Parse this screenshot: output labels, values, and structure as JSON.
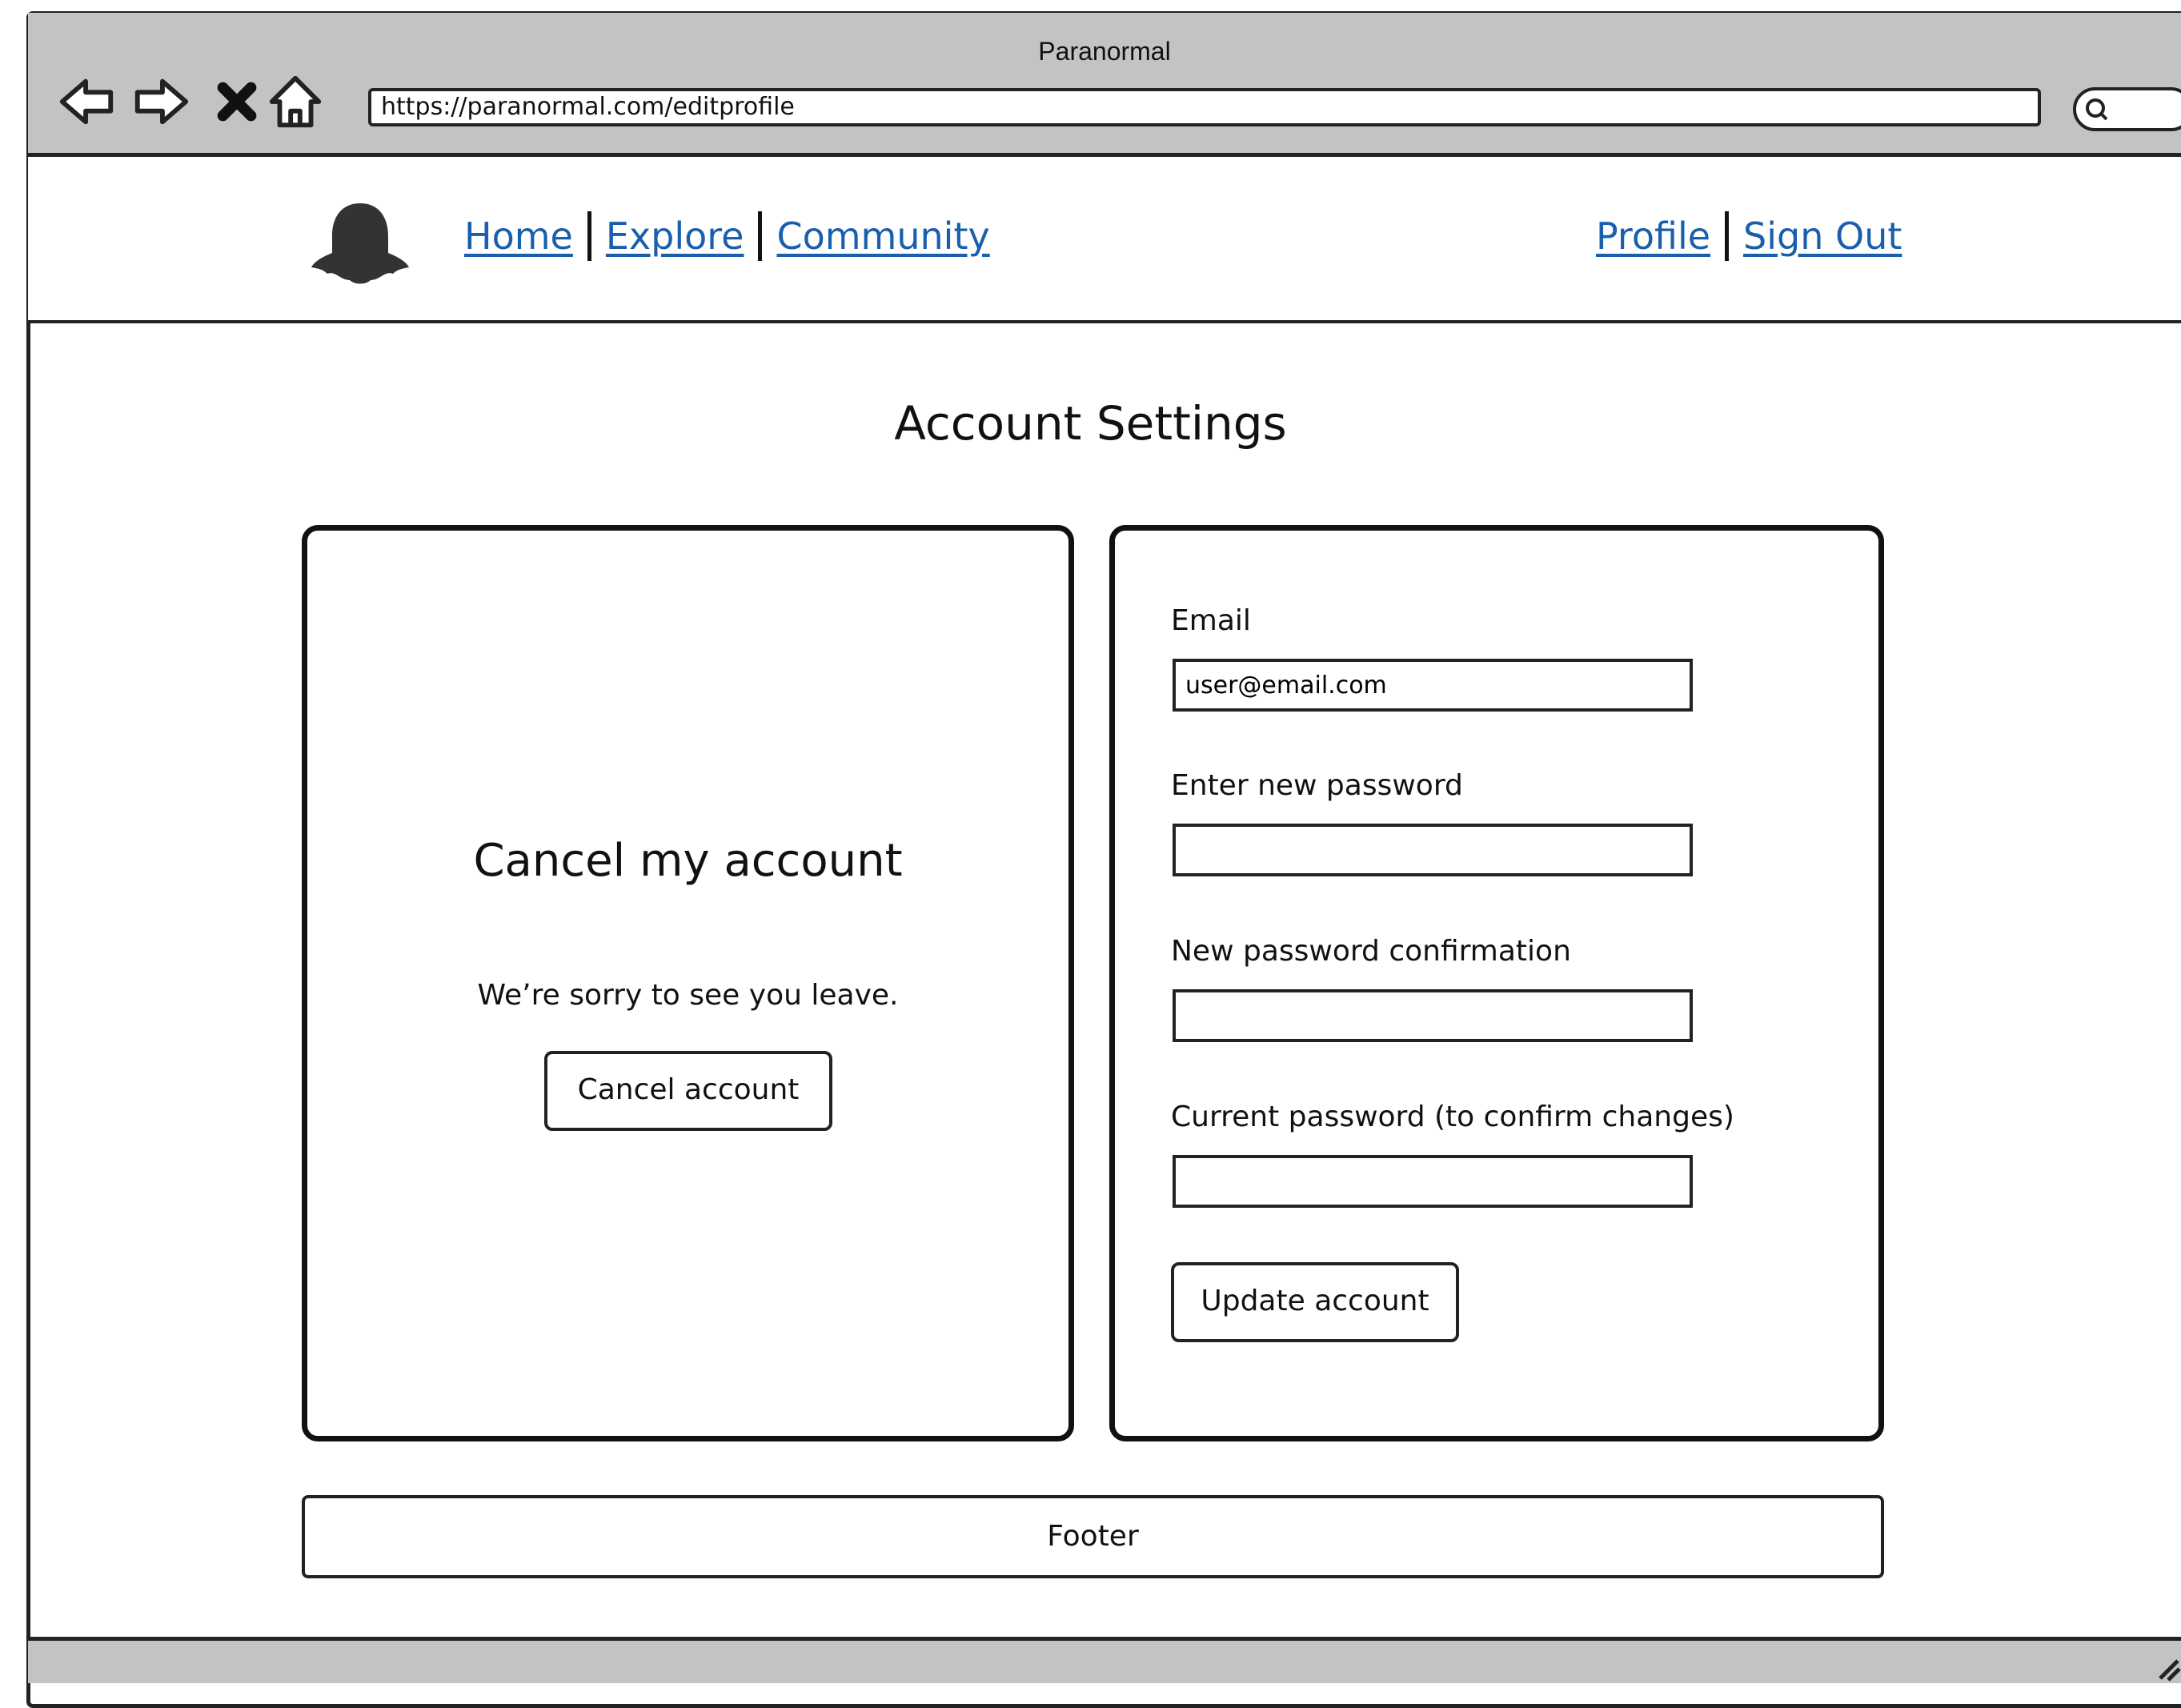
{
  "window": {
    "title": "Paranormal",
    "url": "https://paranormal.com/editprofile"
  },
  "browser_controls": {
    "icons": [
      "back-arrow-icon",
      "forward-arrow-icon",
      "stop-icon",
      "home-icon",
      "search-icon"
    ]
  },
  "header": {
    "logo_icon": "ghost-icon",
    "nav_left": [
      "Home",
      "Explore",
      "Community"
    ],
    "nav_right": [
      "Profile",
      "Sign Out"
    ],
    "link_color": "#1a5fad"
  },
  "main": {
    "title": "Account Settings",
    "cancel_panel": {
      "heading": "Cancel my account",
      "message": "We’re sorry to see you leave.",
      "button_label": "Cancel account"
    },
    "account_form": {
      "email_label": "Email",
      "email_value": "user@email.com",
      "new_password_label": "Enter new password",
      "new_password_value": "",
      "confirm_password_label": "New password confirmation",
      "confirm_password_value": "",
      "current_password_label": "Current password (to confirm changes)",
      "current_password_value": "",
      "submit_label": "Update account"
    }
  },
  "footer": {
    "label": "Footer"
  }
}
